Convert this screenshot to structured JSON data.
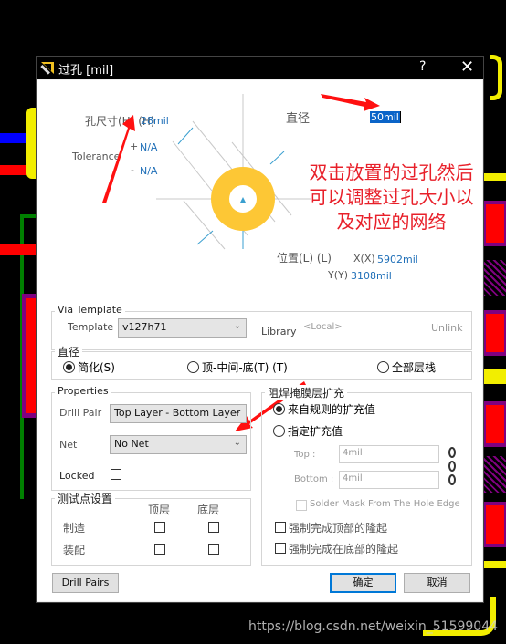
{
  "dialog": {
    "title": "过孔 [mil]",
    "help_label": "?",
    "close_label": "✕"
  },
  "diagram": {
    "hole_size_label": "孔尺寸(H) (H)",
    "hole_size_value": "28mil",
    "tolerance_label": "Tolerance",
    "tol_plus_sign": "+",
    "tol_plus_value": "N/A",
    "tol_minus_sign": "-",
    "tol_minus_value": "N/A",
    "diameter_label": "直径",
    "diameter_value": "50mil",
    "location_label": "位置(L) (L)",
    "x_label": "X(X)",
    "x_value": "5902mil",
    "y_label": "Y(Y)",
    "y_value": "3108mil",
    "pad_color": "#fdc735"
  },
  "annotation": {
    "lines": [
      "双击放置的过孔然后",
      "可以调整过孔大小以",
      "及对应的网络"
    ],
    "color": "#e8202a"
  },
  "via_template": {
    "legend": "Via Template",
    "template_label": "Template",
    "template_value": "v127h71",
    "library_label": "Library",
    "library_value": "<Local>",
    "unlink_label": "Unlink"
  },
  "diameter_mode": {
    "legend": "直径",
    "options": [
      {
        "label": "简化(S)",
        "selected": true
      },
      {
        "label": "顶-中间-底(T) (T)",
        "selected": false
      },
      {
        "label": "全部层栈",
        "selected": false
      }
    ]
  },
  "properties": {
    "legend": "Properties",
    "drill_pair_label": "Drill Pair",
    "drill_pair_value": "Top Layer - Bottom Layer",
    "net_label": "Net",
    "net_value": "No Net",
    "locked_label": "Locked",
    "locked": false
  },
  "solder_mask": {
    "legend": "阻焊掩膜层扩充",
    "options": [
      {
        "label": "来自规则的扩充值",
        "selected": true
      },
      {
        "label": "指定扩充值",
        "selected": false
      }
    ],
    "top_label": "Top :",
    "top_value": "4mil",
    "bottom_label": "Bottom :",
    "bottom_value": "4mil",
    "hole_edge_label": "Solder Mask From The Hole Edge",
    "force_top_label": "强制完成顶部的隆起",
    "force_bottom_label": "强制完成在底部的隆起"
  },
  "testpoint": {
    "legend": "测试点设置",
    "col_top": "顶层",
    "col_bottom": "底层",
    "rows": [
      {
        "label": "制造",
        "top": false,
        "bottom": false
      },
      {
        "label": "装配",
        "top": false,
        "bottom": false
      }
    ]
  },
  "buttons": {
    "drill_pairs": "Drill Pairs",
    "ok": "确定",
    "cancel": "取消"
  },
  "watermark": "https://blog.csdn.net/weixin_51599044"
}
